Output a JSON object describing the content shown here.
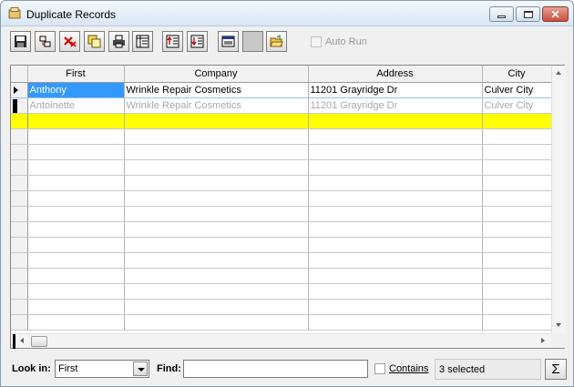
{
  "window": {
    "title": "Duplicate Records",
    "controls": {
      "minimize": "minimize-icon",
      "maximize": "maximize-icon",
      "close": "close-icon"
    }
  },
  "toolbar": {
    "buttons": [
      {
        "name": "save-button",
        "icon": "floppy-disk-icon"
      },
      {
        "name": "merge-button",
        "icon": "merge-records-icon"
      },
      {
        "name": "delete-button",
        "icon": "delete-x-icon"
      },
      {
        "name": "copy-button",
        "icon": "copy-icon"
      },
      {
        "name": "print-button",
        "icon": "printer-icon"
      },
      {
        "name": "columns-button",
        "icon": "columns-icon"
      },
      {
        "name": "sort-ascending-button",
        "icon": "sort-ascending-icon"
      },
      {
        "name": "sort-descending-button",
        "icon": "sort-descending-icon"
      },
      {
        "name": "form-view-button",
        "icon": "form-view-icon"
      },
      {
        "name": "blank-view-button",
        "icon": "blank-view-icon"
      },
      {
        "name": "open-folder-button",
        "icon": "open-folder-icon"
      }
    ],
    "auto_run_label": "Auto Run",
    "auto_run_checked": false
  },
  "grid": {
    "columns": [
      "First",
      "Company",
      "Address",
      "City"
    ],
    "rows": [
      {
        "first": "Anthony",
        "company": "Wrinkle Repair Cosmetics",
        "address": "11201 Grayridge Dr",
        "city": "Culver City",
        "state": "current"
      },
      {
        "first": "Antoinette",
        "company": "Wrinkle Repair Cosmetics",
        "address": "11201 Grayridge Dr",
        "city": "Culver City",
        "state": "dim"
      }
    ],
    "highlight_color": "#ffff00",
    "selection_color": "#3399ff"
  },
  "bottom": {
    "look_in_label": "Look in:",
    "look_in_value": "First",
    "find_label": "Find:",
    "find_value": "",
    "contains_label": "Contains",
    "contains_checked": false,
    "status_text": "3 selected",
    "sigma_label": "Σ"
  }
}
